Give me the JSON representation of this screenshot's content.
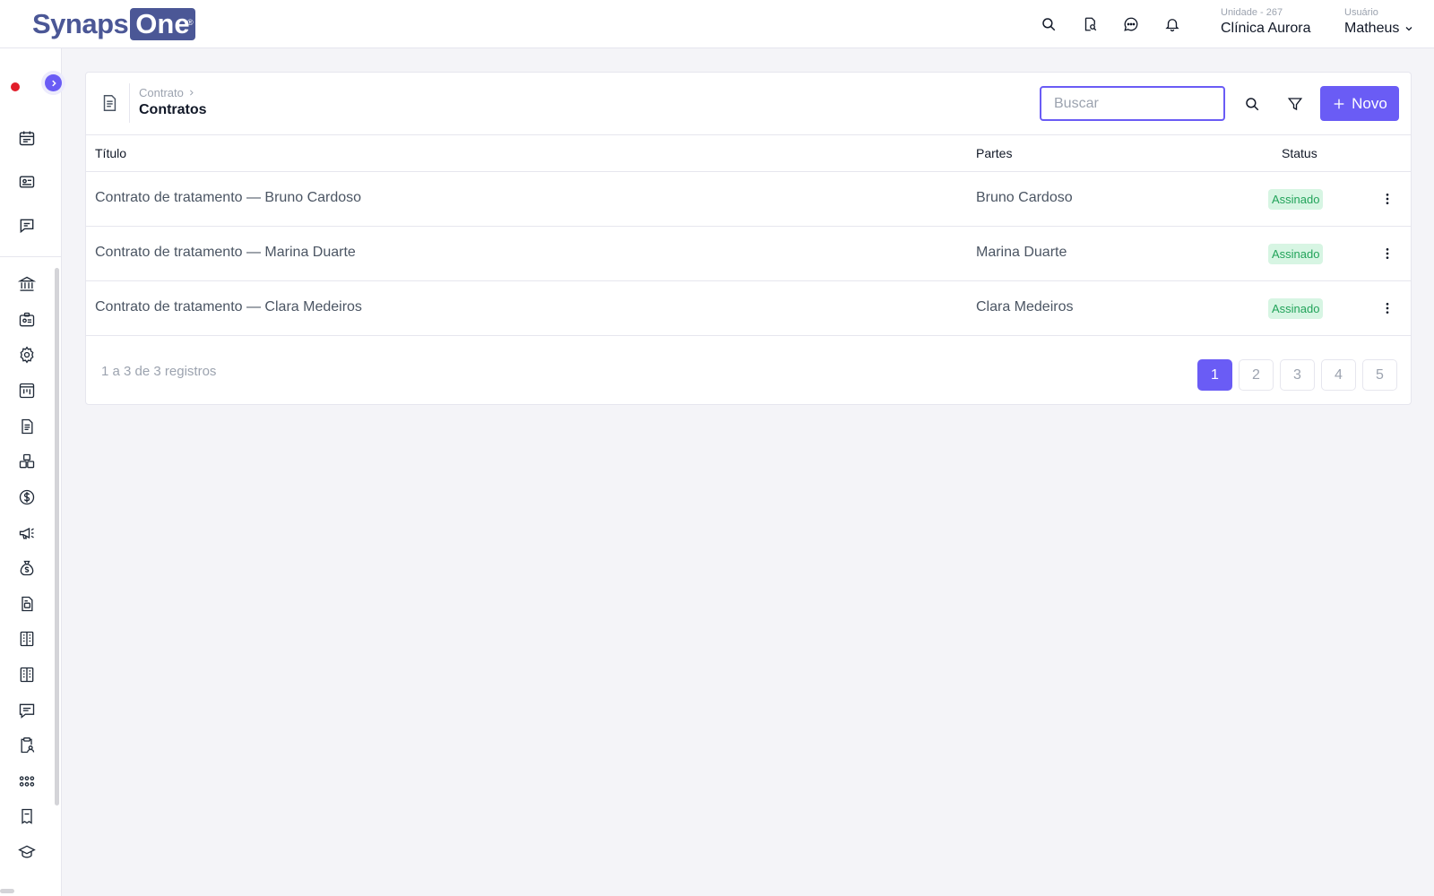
{
  "brand": {
    "name_part1": "Synaps",
    "name_part2": "One",
    "reg_mark": "®"
  },
  "header": {
    "unit_label": "Unidade - 267",
    "unit_value": "Clínica Aurora",
    "user_label": "Usuário",
    "user_value": "Matheus"
  },
  "top_icons": [
    "search-icon",
    "document-search-icon",
    "chat-icon",
    "bell-icon"
  ],
  "sidebar": {
    "top_icons": [
      "calendar-icon",
      "id-card-icon",
      "message-icon"
    ],
    "icons": [
      "bank-icon",
      "badge-icon",
      "gear-icon",
      "board-icon",
      "document-icon",
      "boxes-icon",
      "dollar-icon",
      "megaphone-icon",
      "money-bag-icon",
      "file-text-icon",
      "building-icon",
      "building-alt-icon",
      "comment-list-icon",
      "clipboard-user-icon",
      "dots-grid-icon",
      "tooth-icon",
      "graduation-icon"
    ]
  },
  "page": {
    "breadcrumb": "Contrato",
    "title": "Contratos",
    "search_placeholder": "Buscar",
    "new_button": "Novo"
  },
  "table": {
    "columns": {
      "title": "Título",
      "parties": "Partes",
      "status": "Status"
    },
    "rows": [
      {
        "title": "Contrato de tratamento — Bruno Cardoso",
        "parties": "Bruno Cardoso",
        "status": "Assinado"
      },
      {
        "title": "Contrato de tratamento — Marina Duarte",
        "parties": "Marina Duarte",
        "status": "Assinado"
      },
      {
        "title": "Contrato de tratamento — Clara Medeiros",
        "parties": "Clara Medeiros",
        "status": "Assinado"
      }
    ]
  },
  "footer": {
    "records": "1 a 3 de 3 registros",
    "pages": [
      "1",
      "2",
      "3",
      "4",
      "5"
    ],
    "current_page": "1"
  },
  "colors": {
    "accent": "#6a5cf5",
    "brand": "#4b5796",
    "status_ok_bg": "#d7f5e3",
    "status_ok_text": "#22a35a",
    "recording_dot": "#e11d2a"
  }
}
